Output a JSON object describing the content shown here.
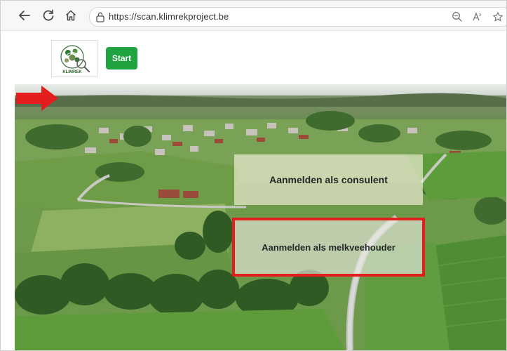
{
  "browser": {
    "url": "https://scan.klimrekproject.be",
    "icons": [
      "back-arrow-icon",
      "reload-icon",
      "home-icon",
      "lock-icon",
      "zoom-out-icon",
      "read-aloud-icon",
      "favorite-star-icon"
    ]
  },
  "header": {
    "start_label": "Start",
    "logo_text": "KLIMREK"
  },
  "hero": {
    "consulent_label": "Aanmelden als consulent",
    "melkveehouder_label": "Aanmelden als melkveehouder",
    "highlight_color": "#e41e1e"
  },
  "colors": {
    "start_button": "#1fa43f",
    "annotation_red": "#e41e1e"
  }
}
